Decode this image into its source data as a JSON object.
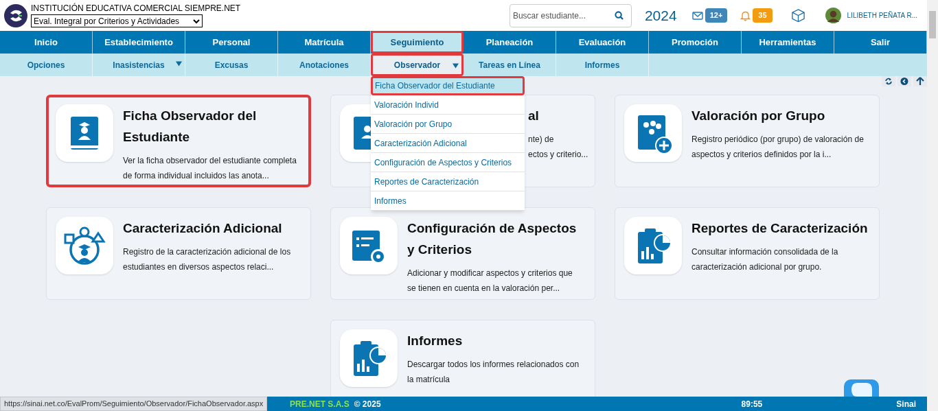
{
  "header": {
    "institution": "INSTITUCIÓN EDUCATIVA COMERCIAL SIEMPRE.NET",
    "module_select": "Eval. Integral por Criterios y Actividades",
    "search": {
      "placeholder": "Buscar estudiante..."
    },
    "year": "2024",
    "messages_badge": "12+",
    "notifications_badge": "35",
    "user_name": "LILIBETH PEÑATA R..."
  },
  "main_nav": [
    {
      "label": "Inicio",
      "selected": false
    },
    {
      "label": "Establecimiento",
      "selected": false
    },
    {
      "label": "Personal",
      "selected": false
    },
    {
      "label": "Matrícula",
      "selected": false
    },
    {
      "label": "Seguimiento",
      "selected": true
    },
    {
      "label": "Planeación",
      "selected": false
    },
    {
      "label": "Evaluación",
      "selected": false
    },
    {
      "label": "Promoción",
      "selected": false
    },
    {
      "label": "Herramientas",
      "selected": false
    },
    {
      "label": "Salir",
      "selected": false
    }
  ],
  "sub_nav": [
    {
      "label": "Opciones",
      "selected": false,
      "has_menu": false
    },
    {
      "label": "Inasistencias",
      "selected": false,
      "has_menu": true
    },
    {
      "label": "Excusas",
      "selected": false,
      "has_menu": false
    },
    {
      "label": "Anotaciones",
      "selected": false,
      "has_menu": false
    },
    {
      "label": "Observador",
      "selected": true,
      "has_menu": true
    },
    {
      "label": "Tareas en Línea",
      "selected": false,
      "has_menu": false
    },
    {
      "label": "Informes",
      "selected": false,
      "has_menu": false
    }
  ],
  "dropdown": [
    {
      "label": "Ficha Observador del Estudiante",
      "selected": true
    },
    {
      "label": "Valoración Individ",
      "selected": false
    },
    {
      "label": "Valoración por Grupo",
      "selected": false
    },
    {
      "label": "Caracterización Adicional",
      "selected": false
    },
    {
      "label": "Configuración de Aspectos y Criterios",
      "selected": false
    },
    {
      "label": "Reportes de Caracterización",
      "selected": false
    },
    {
      "label": "Informes",
      "selected": false
    }
  ],
  "cards": [
    {
      "title": "Ficha Observador del Estudiante",
      "description": [
        "Ver la ficha observador del estudiante completa",
        "de forma individual incluidos las anota..."
      ],
      "selected": true,
      "covered": false
    },
    {
      "title": "al",
      "description": [
        "nte) de",
        "ectos y criterio..."
      ],
      "selected": false,
      "covered": true
    },
    {
      "title": "Valoración por Grupo",
      "description": [
        "Registro periódico (por grupo) de valoración de",
        "aspectos y criterios definidos por la i..."
      ],
      "selected": false,
      "covered": false
    },
    {
      "title": "Caracterización Adicional",
      "description": [
        "Registro de la caracterización adicional de los",
        "estudiantes en diversos aspectos relaci..."
      ],
      "selected": false,
      "covered": false
    },
    {
      "title": "Configuración de Aspectos y Criterios",
      "description": [
        "Adicionar y modificar aspectos y criterios que",
        "se tienen en cuenta en la valoración per..."
      ],
      "selected": false,
      "covered": false
    },
    {
      "title": "Reportes de Caracterización",
      "description": [
        "Consultar información consolidada de la",
        "caracterización adicional por grupo."
      ],
      "selected": false,
      "covered": false
    },
    {
      "title": "Informes",
      "description": [
        "Descargar todos los informes relacionados con",
        "la matrícula"
      ],
      "selected": false,
      "covered": false
    }
  ],
  "footer": {
    "company": "PRE.NET S.A.S",
    "copyright": "© 2025",
    "timer": "89:55",
    "logo": "Sinai"
  },
  "status_url": "https://sinai.net.co/EvalProm/Seguimiento/Observador/FichaObservador.aspx"
}
